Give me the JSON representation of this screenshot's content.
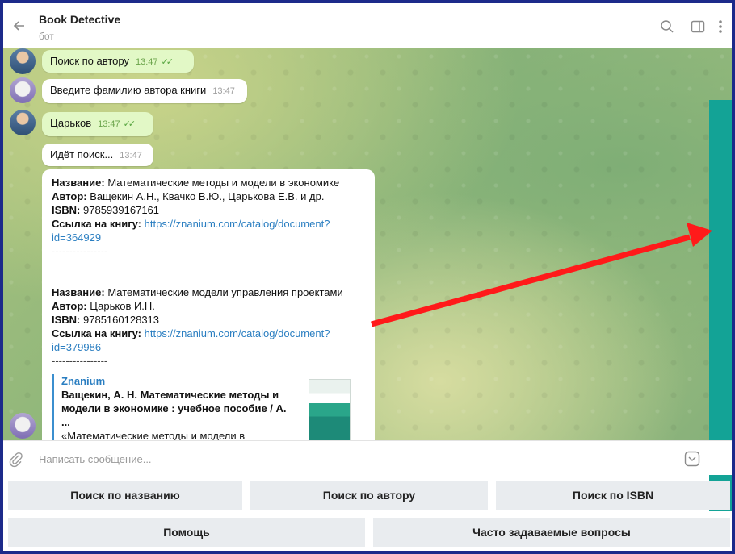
{
  "header": {
    "title": "Book Detective",
    "subtitle": "бот"
  },
  "messages": [
    {
      "text": "Поиск по автору",
      "time": "13:47"
    },
    {
      "text": "Введите фамилию автора книги",
      "time": "13:47"
    },
    {
      "text": "Царьков",
      "time": "13:47"
    },
    {
      "text": "Идёт поиск...",
      "time": "13:47"
    }
  ],
  "results": {
    "label_title": "Название:",
    "label_author": "Автор:",
    "label_isbn": "ISBN:",
    "label_link": "Ссылка на книгу:",
    "separator": "----------------",
    "books": [
      {
        "title": "Математические методы и модели в экономике",
        "author": "Ващекин А.Н., Квачко В.Ю., Царькова Е.В. и др.",
        "isbn": "9785939167161",
        "link_line1": "https://znanium.com/catalog/document?",
        "link_line2": "id=364929"
      },
      {
        "title": "Математические модели управления проектами",
        "author": "Царьков И.Н.",
        "isbn": "9785160128313",
        "link_line1": "https://znanium.com/catalog/document?",
        "link_line2": "id=379986"
      }
    ],
    "preview": {
      "site": "Znanium",
      "title": "Ващекин, А. Н. Математические методы и модели в экономике : учебное пособие / А. ...",
      "description": "«Математические методы и модели в экономике» (Ващекин Андрей Николаевич, К..."
    }
  },
  "input": {
    "placeholder": "Написать сообщение..."
  },
  "keyboard": {
    "row1": [
      "Поиск по названию",
      "Поиск по автору",
      "Поиск по ISBN"
    ],
    "row2": [
      "Помощь",
      "Часто задаваемые вопросы"
    ]
  },
  "colors": {
    "frame_border": "#1c2a8a",
    "outgoing_bubble": "#e2f8c6",
    "link": "#2a7ec1",
    "teal_panel": "#13a396",
    "arrow": "#ff1a1a",
    "keyboard_button": "#e9ecef"
  },
  "icons": [
    "back-arrow-icon",
    "search-icon",
    "sidebar-panel-icon",
    "more-vertical-icon",
    "paperclip-icon",
    "keyboard-toggle-icon"
  ]
}
